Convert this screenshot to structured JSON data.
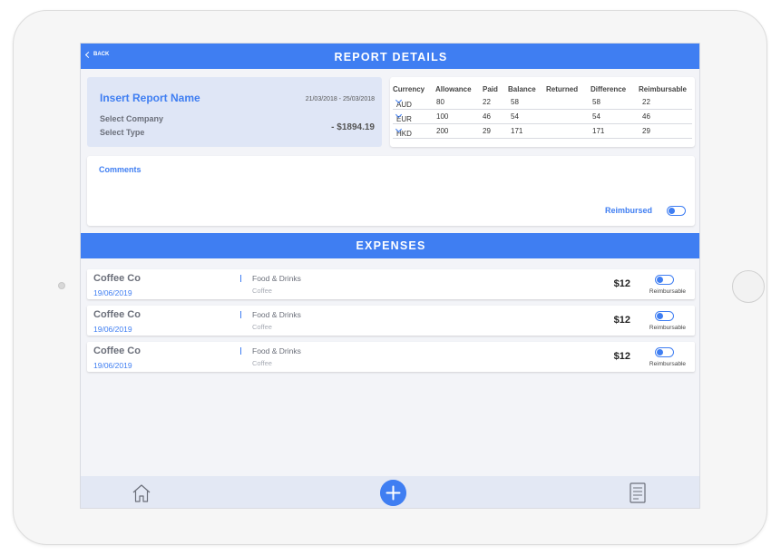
{
  "header": {
    "back_label": "BACK",
    "title": "REPORT DETAILS"
  },
  "report": {
    "name": "Insert Report Name",
    "dates": "21/03/2018 - 25/03/2018",
    "company": "Select Company",
    "type": "Select Type",
    "amount": "- $1894.19"
  },
  "currency_table": {
    "headers": [
      "Currency",
      "Allowance",
      "Paid",
      "Balance",
      "Returned",
      "Difference",
      "Reimbursable"
    ],
    "rows": [
      {
        "currency": "AUD",
        "allowance": "80",
        "paid": "22",
        "balance": "58",
        "returned": "",
        "difference": "58",
        "reimbursable": "22"
      },
      {
        "currency": "EUR",
        "allowance": "100",
        "paid": "46",
        "balance": "54",
        "returned": "",
        "difference": "54",
        "reimbursable": "46"
      },
      {
        "currency": "HKD",
        "allowance": "200",
        "paid": "29",
        "balance": "171",
        "returned": "",
        "difference": "171",
        "reimbursable": "29"
      }
    ]
  },
  "comments": {
    "label": "Comments",
    "reimbursed_label": "Reimbursed",
    "reimbursed_on": true
  },
  "expenses": {
    "title": "EXPENSES",
    "items": [
      {
        "name": "Coffee Co",
        "date": "19/06/2019",
        "category": "Food & Drinks",
        "subcategory": "Coffee",
        "amount": "$12",
        "reimbursable_label": "Reimbursable",
        "reimbursable_on": true
      },
      {
        "name": "Coffee Co",
        "date": "19/06/2019",
        "category": "Food & Drinks",
        "subcategory": "Coffee",
        "amount": "$12",
        "reimbursable_label": "Reimbursable",
        "reimbursable_on": true
      },
      {
        "name": "Coffee Co",
        "date": "19/06/2019",
        "category": "Food & Drinks",
        "subcategory": "Coffee",
        "amount": "$12",
        "reimbursable_label": "Reimbursable",
        "reimbursable_on": true
      }
    ]
  },
  "nav": {
    "icons": [
      "home-icon",
      "add-icon",
      "document-icon"
    ]
  },
  "colors": {
    "accent": "#3f7ef2",
    "card_bg": "#dfe6f6",
    "screen_bg": "#f3f4f8"
  }
}
